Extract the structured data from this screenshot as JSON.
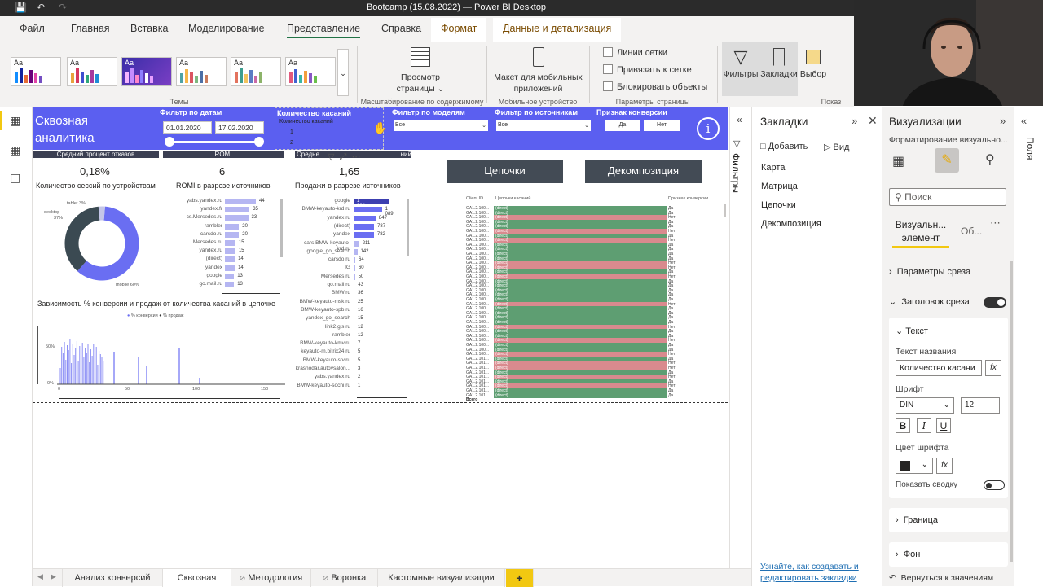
{
  "window": {
    "title": "Bootcamp (15.08.2022) — Power BI Desktop"
  },
  "ribbon_tabs": [
    "Файл",
    "Главная",
    "Вставка",
    "Моделирование",
    "Представление",
    "Справка",
    "Формат",
    "Данные и детализация"
  ],
  "ribbon": {
    "themes_label": "Темы",
    "page_view": "Просмотр страницы",
    "mobile_layout": "Макет для мобильных приложений",
    "scale_label": "Масштабирование по содержимому",
    "mobile_group_label": "Мобильное устройство",
    "gridlines": "Линии сетки",
    "snap": "Привязать к сетке",
    "lock": "Блокировать объекты",
    "page_options_label": "Параметры страницы",
    "filters": "Фильтры",
    "bookmarks": "Закладки",
    "selection": "Выбор",
    "show_label": "Показ"
  },
  "report": {
    "title": "Сквозная аналитика",
    "date_filter_label": "Фильтр по датам",
    "date_from": "01.01.2020",
    "date_to": "17.02.2020",
    "touches_label": "Количество касаний",
    "touches_header": "Количество касаний",
    "touches_opt1": "1",
    "touches_opt2": "2",
    "models_label": "Фильтр по моделям",
    "models_value": "Все",
    "sources_label": "Фильтр по источникам",
    "sources_value": "Все",
    "conv_label": "Признак конверсии",
    "conv_yes": "Да",
    "conv_no": "Нет",
    "kpi1_header": "Средний процент отказов",
    "kpi1_value": "0,18%",
    "kpi2_header": "ROMI",
    "kpi2_value": "6",
    "kpi3_header": "Средне...",
    "kpi3_header_right": "...ний",
    "kpi3_value": "1,65",
    "donut_title": "Количество сессий по устройствам",
    "donut_labels": {
      "tablet": "tablet 3%",
      "desktop": "desktop",
      "desktop_pct": "37%",
      "mobile": "mobile 60%"
    },
    "romi_title": "ROMI в разрезе источников",
    "sales_title": "Продажи в разрезе источников",
    "scatter_title": "Зависимость % конверсии и продаж от количества касаний в цепочке",
    "scatter_legend": [
      "% конверсии",
      "% продаж"
    ],
    "scatter_y": [
      "50%",
      "0%"
    ],
    "scatter_x": [
      "0",
      "50",
      "100",
      "150"
    ],
    "btn_chains": "Цепочки",
    "btn_decomp": "Декомпозиция",
    "table_headers": [
      "Client ID",
      "Цепочки касаний",
      "Признак конверсии"
    ],
    "table_total": "Всего"
  },
  "romi_bars": [
    {
      "label": "yabs.yandex.ru",
      "value": 44
    },
    {
      "label": "yandex.fr",
      "value": 35
    },
    {
      "label": "cs.Mersedes.ru",
      "value": 33
    },
    {
      "label": "rambler",
      "value": 20
    },
    {
      "label": "carsdo.ru",
      "value": 20
    },
    {
      "label": "Mersedes.ru",
      "value": 15
    },
    {
      "label": "yandex.ru",
      "value": 15
    },
    {
      "label": "(direct)",
      "value": 14
    },
    {
      "label": "yandex",
      "value": 14
    },
    {
      "label": "google",
      "value": 13
    },
    {
      "label": "go.mail.ru",
      "value": 13
    }
  ],
  "sales_bars": [
    {
      "label": "google",
      "value": "1 384"
    },
    {
      "label": "BMW-keyauto-krd.ru",
      "value": "1 089"
    },
    {
      "label": "yandex.ru",
      "value": "847"
    },
    {
      "label": "(direct)",
      "value": "787"
    },
    {
      "label": "yandex",
      "value": "782"
    },
    {
      "label": "cars.BMW-keyauto-krd.ru",
      "value": "211"
    },
    {
      "label": "google_go_search",
      "value": "142"
    },
    {
      "label": "carsdo.ru",
      "value": "64"
    },
    {
      "label": "IG",
      "value": "60"
    },
    {
      "label": "Mersedes.ru",
      "value": "50"
    },
    {
      "label": "go.mail.ru",
      "value": "43"
    },
    {
      "label": "BMW.ru",
      "value": "36"
    },
    {
      "label": "BMW-keyauto-msk.ru",
      "value": "25"
    },
    {
      "label": "BMW-keyauto-spb.ru",
      "value": "16"
    },
    {
      "label": "yandex_go_search",
      "value": "15"
    },
    {
      "label": "link2.gis.ru",
      "value": "12"
    },
    {
      "label": "rambler",
      "value": "12"
    },
    {
      "label": "BMW-keyauto-kmv.ru",
      "value": "7"
    },
    {
      "label": "keyauto-m.bitrix24.ru",
      "value": "5"
    },
    {
      "label": "BMW-keyauto-stv.ru",
      "value": "5"
    },
    {
      "label": "krasnodar.autovsalon...",
      "value": "3"
    },
    {
      "label": "yabs.yandex.ru",
      "value": "2"
    },
    {
      "label": "BMW-keyauto-sochi.ru",
      "value": "1"
    }
  ],
  "table_rows": [
    "Да",
    "Да",
    "Нет",
    "Да",
    "Да",
    "Нет",
    "Да",
    "Нет",
    "Да",
    "Да",
    "Да",
    "Да",
    "Нет",
    "Нет",
    "Да",
    "Нет",
    "Да",
    "Да",
    "Да",
    "Да",
    "Да",
    "Нет",
    "Да",
    "Да",
    "Да",
    "Да",
    "Нет",
    "Да",
    "Да",
    "Нет",
    "Да",
    "Да",
    "Нет",
    "Да",
    "Нет",
    "Нет",
    "Да",
    "Нет",
    "Да",
    "Нет",
    "Да",
    "Да"
  ],
  "table_row_id": "GA1.2.100...",
  "table_row_id2": "GA1.2.101...",
  "table_row_chain": "(direct)",
  "filters_pane": {
    "label": "Фильтры"
  },
  "bookmarks_pane": {
    "title": "Закладки",
    "add": "Добавить",
    "view": "Вид",
    "items": [
      "Карта",
      "Матрица",
      "Цепочки",
      "Декомпозиция"
    ],
    "help_link": "Узнайте, как создавать и редактировать закладки"
  },
  "viz_pane": {
    "title": "Визуализации",
    "subtitle": "Форматирование визуально...",
    "search_placeholder": "Поиск",
    "tab_visual": "Визуальн... элемент",
    "tab_general": "Об...",
    "section_slicer_settings": "Параметры среза",
    "section_slicer_header": "Заголовок среза",
    "sub_text": "Текст",
    "title_text_label": "Текст названия",
    "title_text_value": "Количество касани",
    "font_label": "Шрифт",
    "font_value": "DIN",
    "font_size": "12",
    "font_color_label": "Цвет шрифта",
    "show_tooltip": "Показать сводку",
    "section_border": "Граница",
    "section_bg": "Фон",
    "reset": "Вернуться к значениям"
  },
  "fields_pane": {
    "label": "Поля"
  },
  "page_tabs": [
    "Анализ конверсий",
    "Сквозная",
    "Методология",
    "Воронка",
    "Кастомные визуализации"
  ],
  "add_page": "+",
  "colors": {
    "accent": "#5b5ff0",
    "dark": "#3b3f52",
    "green": "#5e9e72",
    "red": "#d98a8e",
    "yellow": "#f2c811"
  }
}
